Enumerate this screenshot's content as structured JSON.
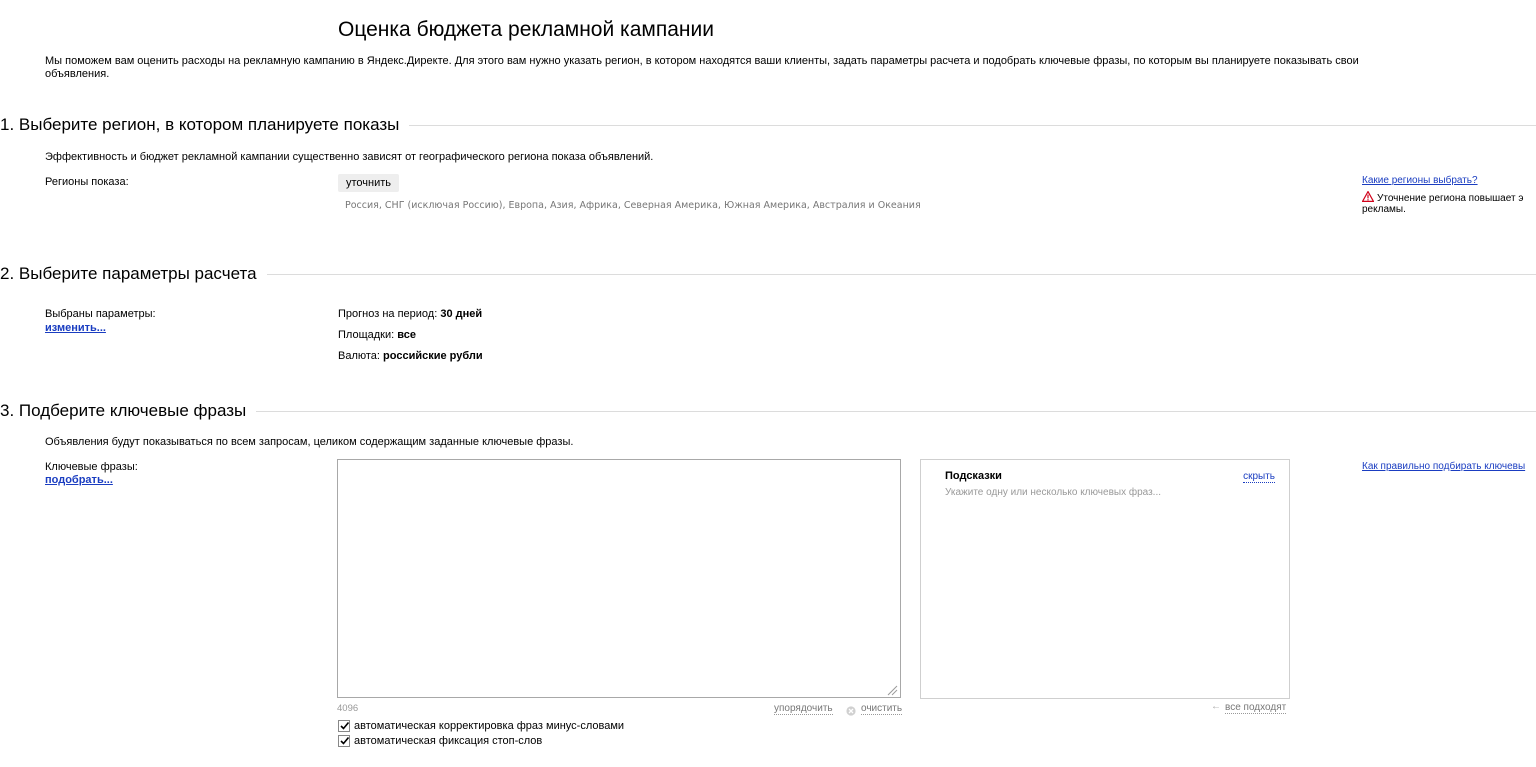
{
  "page": {
    "title": "Оценка бюджета рекламной кампании",
    "intro": "Мы поможем вам оценить расходы на рекламную кампанию в Яндекс.Директе. Для этого вам нужно указать регион, в котором находятся ваши клиенты, задать параметры расчета и подобрать ключевые фразы, по которым вы планируете показывать свои объявления."
  },
  "section1": {
    "title": "1. Выберите регион, в котором планируете показы",
    "description": "Эффективность и бюджет рекламной кампании существенно зависят от географического региона показа объявлений.",
    "regions_label": "Регионы показа:",
    "refine_button": "уточнить",
    "regions_value": "Россия, СНГ (исключая Россию), Европа, Азия, Африка, Северная Америка, Южная Америка, Австралия и Океания",
    "help_link": "Какие регионы выбрать?",
    "warning_text": "Уточнение региона повышает э рекламы."
  },
  "section2": {
    "title": "2. Выберите параметры расчета",
    "params_label": "Выбраны параметры:",
    "change_link": "изменить...",
    "period_label": "Прогноз на период:",
    "period_value": "30 дней",
    "platforms_label": "Площадки:",
    "platforms_value": "все",
    "currency_label": "Валюта:",
    "currency_value": "российские рубли"
  },
  "section3": {
    "title": "3. Подберите ключевые фразы",
    "description": "Объявления будут показываться по всем запросам, целиком содержащим заданные ключевые фразы.",
    "phrases_label": "Ключевые фразы:",
    "pick_link": "подобрать...",
    "help_link": "Как правильно подбирать ключевы",
    "textarea_value": "",
    "char_counter": "4096",
    "sort_link": "упорядочить",
    "clear_link": "очистить",
    "hints": {
      "title": "Подсказки",
      "hide_link": "скрыть",
      "text": "Укажите одну или несколько ключевых фраз...",
      "all_fit_link": "все подходят"
    },
    "options": [
      {
        "label": "автоматическая корректировка фраз минус-словами",
        "checked": true
      },
      {
        "label": "автоматическая фиксация стоп-слов",
        "checked": true
      }
    ]
  },
  "colors": {
    "link": "#1a3dc1",
    "muted": "#777777",
    "warning": "#d0021b"
  }
}
